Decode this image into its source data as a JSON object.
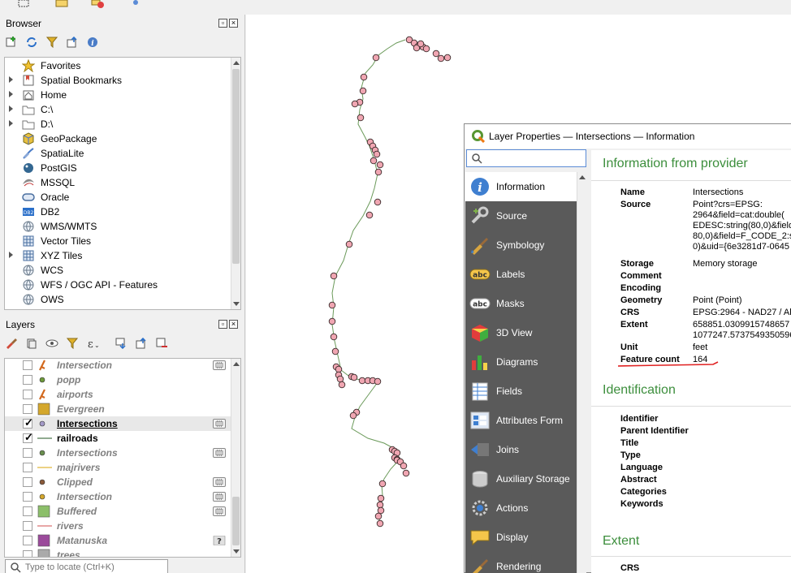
{
  "browser": {
    "title": "Browser",
    "items": [
      {
        "label": "Favorites",
        "icon": "star-icon",
        "arrow": false
      },
      {
        "label": "Spatial Bookmarks",
        "icon": "bookmark-icon",
        "arrow": true
      },
      {
        "label": "Home",
        "icon": "home-folder-icon",
        "arrow": true
      },
      {
        "label": "C:\\",
        "icon": "folder-icon",
        "arrow": true
      },
      {
        "label": "D:\\",
        "icon": "folder-icon",
        "arrow": true
      },
      {
        "label": "GeoPackage",
        "icon": "geopackage-icon",
        "arrow": false
      },
      {
        "label": "SpatiaLite",
        "icon": "spatialite-icon",
        "arrow": false
      },
      {
        "label": "PostGIS",
        "icon": "postgis-icon",
        "arrow": false
      },
      {
        "label": "MSSQL",
        "icon": "mssql-icon",
        "arrow": false
      },
      {
        "label": "Oracle",
        "icon": "oracle-icon",
        "arrow": false
      },
      {
        "label": "DB2",
        "icon": "db2-icon",
        "arrow": false
      },
      {
        "label": "WMS/WMTS",
        "icon": "globe-icon",
        "arrow": false
      },
      {
        "label": "Vector Tiles",
        "icon": "grid-icon",
        "arrow": false
      },
      {
        "label": "XYZ Tiles",
        "icon": "grid-icon",
        "arrow": true
      },
      {
        "label": "WCS",
        "icon": "globe-icon",
        "arrow": false
      },
      {
        "label": "WFS / OGC API - Features",
        "icon": "globe-icon",
        "arrow": false
      },
      {
        "label": "OWS",
        "icon": "globe-icon",
        "arrow": false
      }
    ]
  },
  "layers": {
    "title": "Layers",
    "items": [
      {
        "label": "Intersection",
        "symbol": "star-marker",
        "color": "#d2691e",
        "checked": false,
        "badge": true
      },
      {
        "label": "popp",
        "symbol": "dot",
        "color": "#6e9a3a",
        "checked": false,
        "badge": false
      },
      {
        "label": "airports",
        "symbol": "star-marker",
        "color": "#d2691e",
        "checked": false,
        "badge": false
      },
      {
        "label": "Evergreen",
        "symbol": "fill",
        "color": "#d4a72c",
        "checked": false,
        "badge": false
      },
      {
        "label": "Intersections",
        "symbol": "dot",
        "color": "#a49ac8",
        "checked": true,
        "badge": true,
        "selected": true
      },
      {
        "label": "railroads",
        "symbol": "line",
        "color": "#6b8e6b",
        "checked": true,
        "badge": false
      },
      {
        "label": "Intersections",
        "symbol": "dot",
        "color": "#6a8f4f",
        "checked": false,
        "badge": true
      },
      {
        "label": "majrivers",
        "symbol": "line",
        "color": "#e6c35c",
        "checked": false,
        "badge": false
      },
      {
        "label": "Clipped",
        "symbol": "dot",
        "color": "#8a5a3a",
        "checked": false,
        "badge": true
      },
      {
        "label": "Intersection",
        "symbol": "dot",
        "color": "#d4a72c",
        "checked": false,
        "badge": true
      },
      {
        "label": "Buffered",
        "symbol": "fill",
        "color": "#8cbf6a",
        "checked": false,
        "badge": true
      },
      {
        "label": "rivers",
        "symbol": "line",
        "color": "#e08a8a",
        "checked": false,
        "badge": false
      },
      {
        "label": "Matanuska",
        "symbol": "fill",
        "color": "#9b4a9b",
        "checked": false,
        "badge": false,
        "help": true
      },
      {
        "label": "trees",
        "symbol": "fill",
        "color": "#aaaaaa",
        "checked": false,
        "badge": false
      }
    ]
  },
  "locator": {
    "placeholder": "Type to locate (Ctrl+K)"
  },
  "dialog": {
    "title": "Layer Properties — Intersections — Information",
    "search_value": "",
    "nav": [
      {
        "label": "Information",
        "icon": "info-icon",
        "active": true
      },
      {
        "label": "Source",
        "icon": "source-wrench-icon"
      },
      {
        "label": "Symbology",
        "icon": "symbology-brush-icon"
      },
      {
        "label": "Labels",
        "icon": "labels-abc-icon"
      },
      {
        "label": "Masks",
        "icon": "masks-abc-icon"
      },
      {
        "label": "3D View",
        "icon": "cube-3d-icon"
      },
      {
        "label": "Diagrams",
        "icon": "diagrams-chart-icon"
      },
      {
        "label": "Fields",
        "icon": "fields-icon"
      },
      {
        "label": "Attributes Form",
        "icon": "attributes-form-icon"
      },
      {
        "label": "Joins",
        "icon": "joins-icon"
      },
      {
        "label": "Auxiliary Storage",
        "icon": "database-icon"
      },
      {
        "label": "Actions",
        "icon": "actions-gear-icon"
      },
      {
        "label": "Display",
        "icon": "display-bubble-icon"
      },
      {
        "label": "Rendering",
        "icon": "rendering-brush-icon"
      }
    ],
    "info": {
      "heading": "Information from provider",
      "rows": [
        {
          "k": "Name",
          "v": [
            "Intersections"
          ]
        },
        {
          "k": "Source",
          "v": [
            "Point?crs=EPSG:",
            "2964&field=cat:double(",
            "EDESC:string(80,0)&field",
            "80,0)&field=F_CODE_2:s",
            "0)&uid={6e3281d7-0645"
          ]
        },
        {
          "k": "Storage",
          "v": [
            "Memory storage"
          ]
        },
        {
          "k": "Comment",
          "v": [
            ""
          ]
        },
        {
          "k": "Encoding",
          "v": [
            ""
          ]
        },
        {
          "k": "Geometry",
          "v": [
            "Point (Point)"
          ]
        },
        {
          "k": "CRS",
          "v": [
            "EPSG:2964 - NAD27 / Ala"
          ]
        },
        {
          "k": "Extent",
          "v": [
            "658851.0309915748657",
            "1077247.5737549350596"
          ]
        },
        {
          "k": "Unit",
          "v": [
            "feet"
          ]
        },
        {
          "k": "Feature count",
          "v": [
            "164"
          ]
        }
      ]
    },
    "identification": {
      "heading": "Identification",
      "keys": [
        "Identifier",
        "Parent Identifier",
        "Title",
        "Type",
        "Language",
        "Abstract",
        "Categories",
        "Keywords"
      ]
    },
    "extent": {
      "heading": "Extent",
      "keys": [
        "CRS"
      ]
    }
  },
  "colors": {
    "point_fill": "#f0a6b2",
    "point_stroke": "#3a2a2a",
    "line": "#6b9a5a",
    "heading_green": "#3c8e3c",
    "annotation_red": "#e02020"
  }
}
